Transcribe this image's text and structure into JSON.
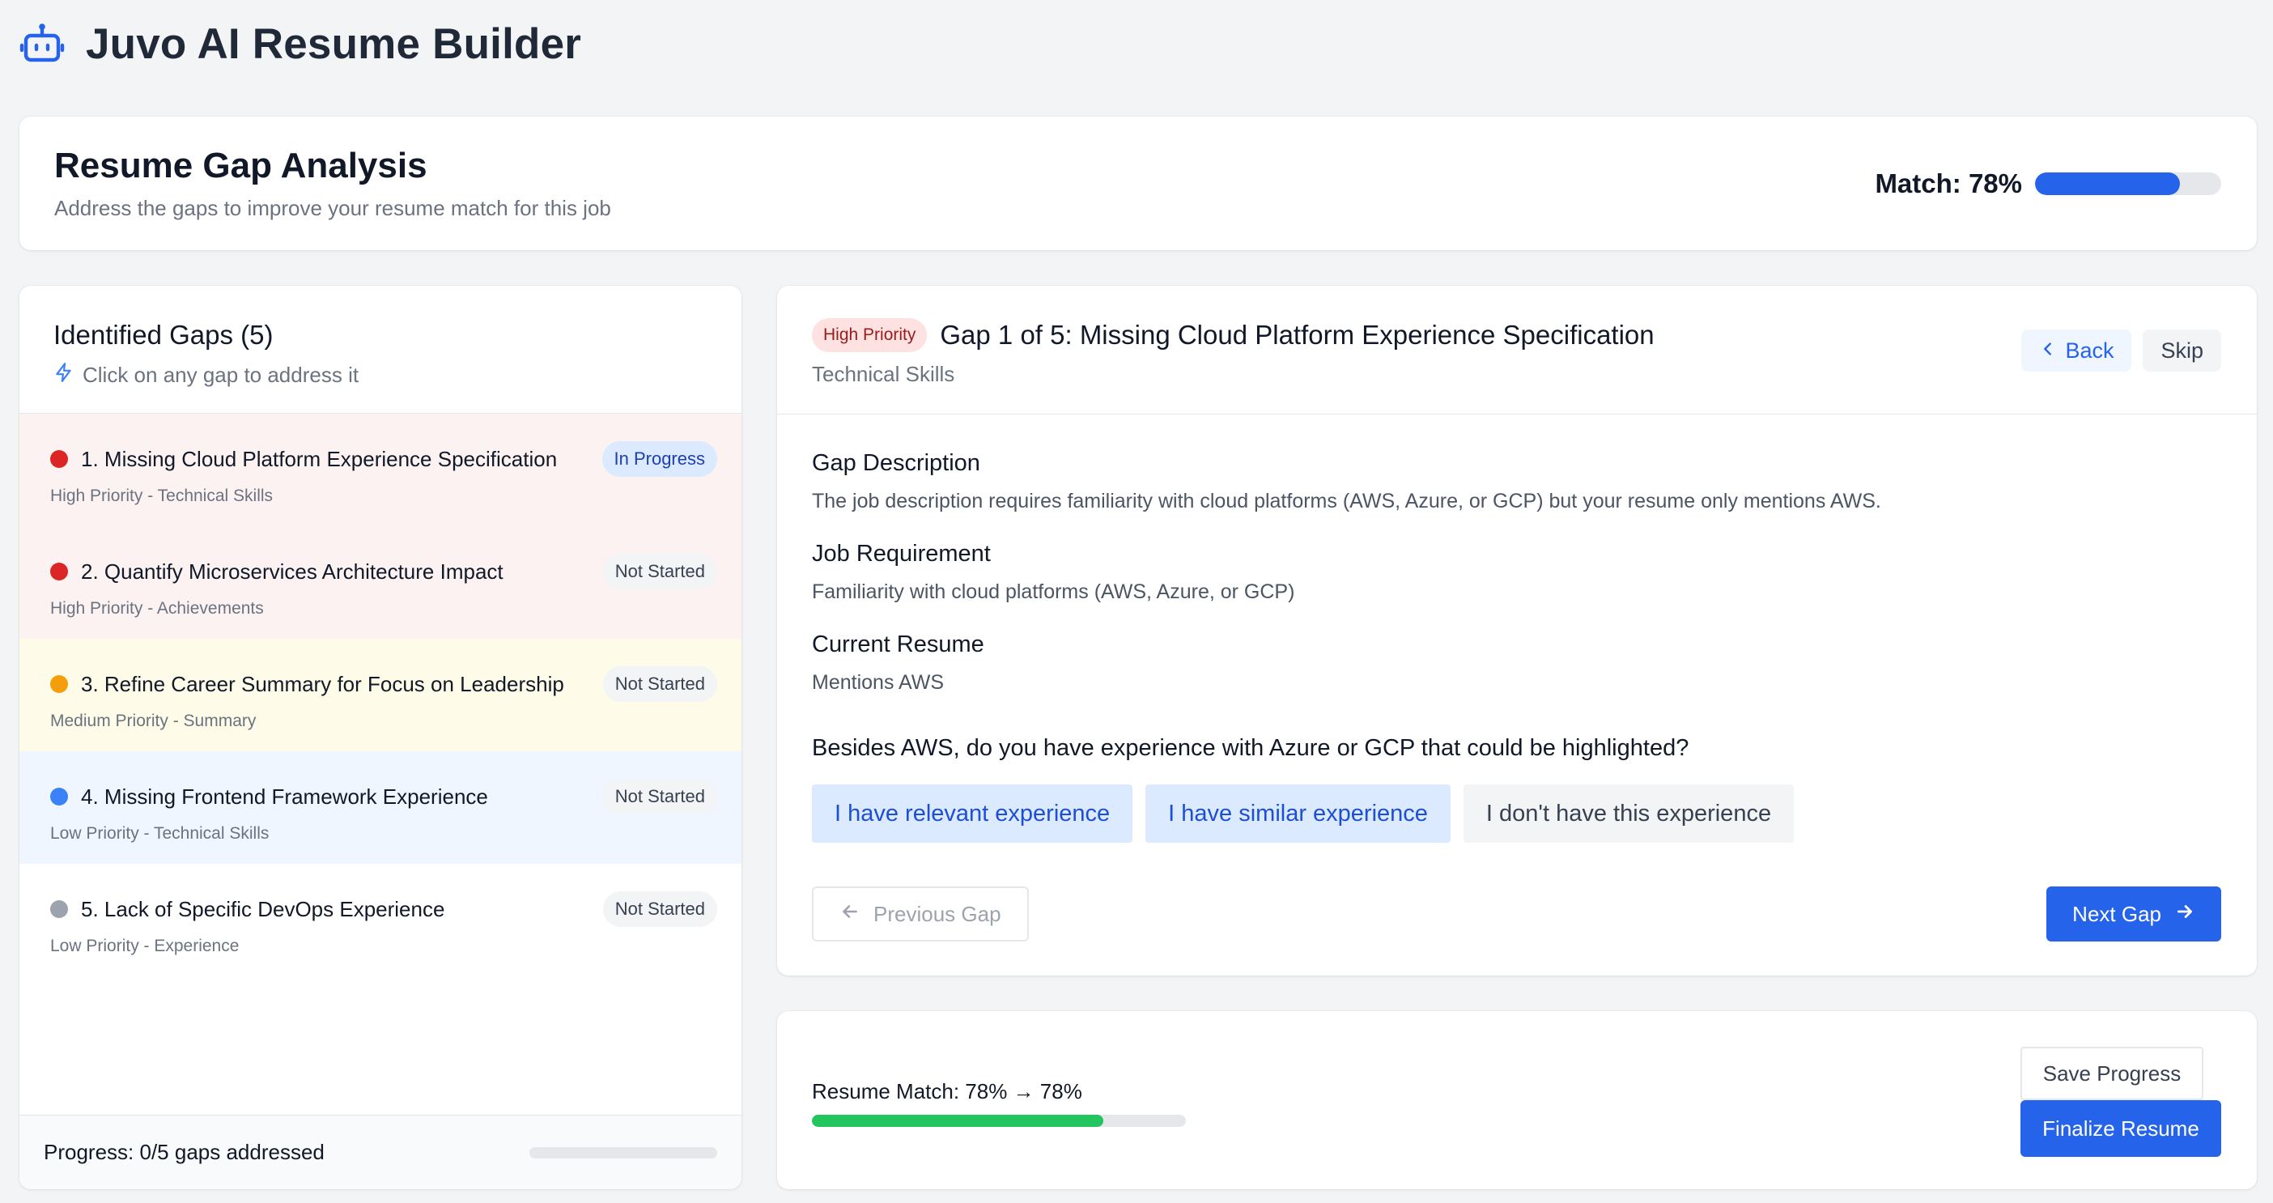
{
  "app": {
    "title": "Juvo AI Resume Builder",
    "logo_icon": "robot-icon",
    "accent": "#2563eb"
  },
  "analysis": {
    "title": "Resume Gap Analysis",
    "subtitle": "Address the gaps to improve your resume match for this job",
    "match_label": "Match: 78%",
    "match_value": 78
  },
  "gaps": {
    "title": "Identified Gaps (5)",
    "hint": "Click on any gap to address it",
    "hint_icon": "lightning-icon",
    "items": [
      {
        "title": "1. Missing Cloud Platform Experience Specification",
        "meta": "High Priority - Technical Skills",
        "status": "In Progress",
        "dot": "#dc2626",
        "bg": "#fdf2f2",
        "status_style": "inprog"
      },
      {
        "title": "2. Quantify Microservices Architecture Impact",
        "meta": "High Priority - Achievements",
        "status": "Not Started",
        "dot": "#dc2626",
        "bg": "#fdf2f2",
        "status_style": "default"
      },
      {
        "title": "3. Refine Career Summary for Focus on Leadership",
        "meta": "Medium Priority - Summary",
        "status": "Not Started",
        "dot": "#f59e0b",
        "bg": "#fefce8",
        "status_style": "default"
      },
      {
        "title": "4. Missing Frontend Framework Experience",
        "meta": "Low Priority - Technical Skills",
        "status": "Not Started",
        "dot": "#3b82f6",
        "bg": "#eff6ff",
        "status_style": "default"
      },
      {
        "title": "5. Lack of Specific DevOps Experience",
        "meta": "Low Priority - Experience",
        "status": "Not Started",
        "dot": "#9ca3af",
        "bg": "#ffffff",
        "status_style": "default"
      }
    ],
    "progress_text": "Progress: 0/5 gaps addressed",
    "progress_value": 0
  },
  "detail": {
    "priority_badge": "High Priority",
    "title": "Gap 1 of 5: Missing Cloud Platform Experience Specification",
    "category": "Technical Skills",
    "back_label": "Back",
    "skip_label": "Skip",
    "sections": [
      {
        "title": "Gap Description",
        "text": "The job description requires familiarity with cloud platforms (AWS, Azure, or GCP) but your resume only mentions AWS."
      },
      {
        "title": "Job Requirement",
        "text": "Familiarity with cloud platforms (AWS, Azure, or GCP)"
      },
      {
        "title": "Current Resume",
        "text": "Mentions AWS"
      }
    ],
    "question": "Besides AWS, do you have experience with Azure or GCP that could be highlighted?",
    "answers": [
      {
        "label": "I have relevant experience",
        "style": "blue"
      },
      {
        "label": "I have similar experience",
        "style": "blue"
      },
      {
        "label": "I don't have this experience",
        "style": "gray"
      }
    ],
    "prev_label": "Previous Gap",
    "next_label": "Next Gap"
  },
  "summary": {
    "match_text": "Resume Match: 78% → 78%",
    "match_value": 78,
    "save_label": "Save Progress",
    "finalize_label": "Finalize Resume"
  }
}
